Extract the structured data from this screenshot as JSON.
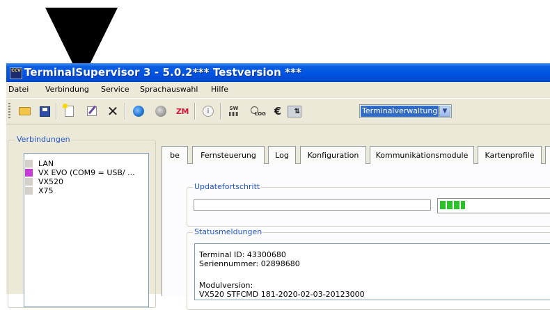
{
  "window": {
    "title": "TerminalSupervisor 3 - 5.0.2*** Testversion ***",
    "app_icon_text": "CCV"
  },
  "menu": [
    "Datei",
    "Verbindung",
    "Service",
    "Sprachauswahl",
    "Hilfe"
  ],
  "toolbar": {
    "icons": [
      "open-folder-icon",
      "save-disk-icon",
      "new-icon",
      "edit-icon",
      "delete-icon",
      "globe-connect-icon",
      "globe-disconnect-icon",
      "zm-icon",
      "info-icon",
      "sw-icon",
      "log-icon",
      "euro-icon",
      "swap-icon"
    ],
    "zm_label": "ZM",
    "sw_label": "SW",
    "log_label": "LOG",
    "euro_label": "€",
    "x_label": "✕",
    "info_label": "i",
    "combo_value": "Terminalverwaltung"
  },
  "connections": {
    "legend": "Verbindungen",
    "items": [
      {
        "label": "LAN",
        "color": "#d4d0c8"
      },
      {
        "label": "VX EVO (COM9 = USB/ ...",
        "color": "#c83ad6"
      },
      {
        "label": "VX520",
        "color": "#d4d0c8"
      },
      {
        "label": "X75",
        "color": "#d4d0c8"
      }
    ]
  },
  "tabs": [
    "be",
    "Fernsteuerung",
    "Log",
    "Konfiguration",
    "Kommunikationsmodule",
    "Kartenprofile"
  ],
  "update": {
    "legend": "Updatefortschritt",
    "progress_fraction": 0.22
  },
  "status": {
    "legend": "Statusmeldungen",
    "lines": [
      "Terminal ID: 43300680",
      "Seriennummer: 02898680",
      "",
      "Modulversion:",
      "VX520 STFCMD 181-2020-02-03-20123000"
    ]
  },
  "colors": {
    "titlebar": "#0054e3",
    "selected": "#316ac5",
    "group_legend": "#2055c8",
    "progress": "#2bc12b"
  }
}
